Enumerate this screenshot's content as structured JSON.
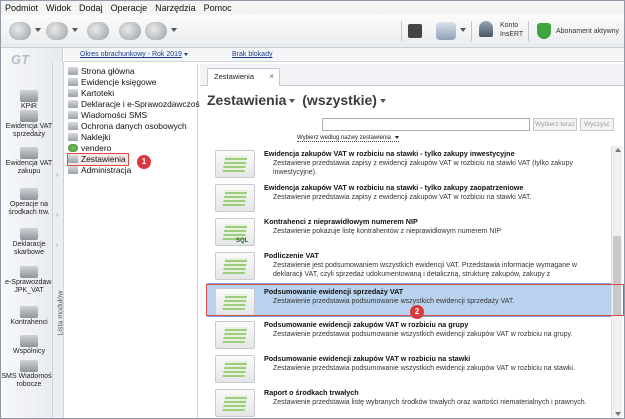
{
  "menu": [
    "Podmiot",
    "Widok",
    "Dodaj",
    "Operacje",
    "Narzędzia",
    "Pomoc"
  ],
  "toolbar": {
    "konto_line1": "Konto",
    "konto_line2": "InsERT",
    "abonament": "Abonament aktywny"
  },
  "period": {
    "label": "Okres obrachunkowy - Rok 2019",
    "blokady": "Brak blokady"
  },
  "leftbar": {
    "logo": "GT",
    "items": [
      "KPiR",
      "Ewidencja VAT sprzedaży",
      "Ewidencja VAT zakupu",
      "Operacje na środkach trw.",
      "Deklaracje skarbowe",
      "e-Sprawozdaw. JPK_VAT",
      "Kontrahenci",
      "Wspólnicy",
      "SMS Wiadomości robocze"
    ],
    "vertical_label": "Lista modułów"
  },
  "nav": {
    "items": [
      "Strona główna",
      "Ewidencje księgowe",
      "Kartoteki",
      "Deklaracje i e-Sprawozdawczość",
      "Wiadomości SMS",
      "Ochrona danych osobowych",
      "Naklejki",
      "vendero",
      "Zestawienia",
      "Administracja"
    ],
    "selected_index": 8,
    "badge": "1"
  },
  "main": {
    "tab_label": "Zestawienia",
    "heading_main": "Zestawienia",
    "heading_filter": "(wszystkie)",
    "search_placeholder": "",
    "search_button": "Wybierz teraz",
    "clear_button": "Wyczyść",
    "sort_label": "Wybierz według nazwy zestawienia",
    "badge": "2",
    "rows": [
      {
        "title": "Ewidencja zakupów VAT w rozbiciu na stawki - tylko zakupy inwestycyjne",
        "desc": "Zestawienie przedstawia zapisy z ewidencji zakupów VAT w rozbiciu na stawki VAT (tylko zakupy inwestycyjne)."
      },
      {
        "title": "Ewidencja zakupów VAT w rozbiciu na stawki - tylko zakupy zaopatrzeniowe",
        "desc": "Zestawienie przedstawia zapisy z ewidencji zakupów VAT w rozbiciu na stawki VAT."
      },
      {
        "title": "Kontrahenci z nieprawidłowym numerem NIP",
        "desc": "Zestawienie pokazuje listę kontrahentów z nieprawidłowym numerem NIP"
      },
      {
        "title": "Podliczenie VAT",
        "desc": "Zestawienie jest podsumowaniem wszystkich ewidencji VAT. Przedstawia informacje wymagane w deklaracji VAT, czyli sprzedaż udokumentowaną i detaliczną, strukturę zakupów, zakupy z"
      },
      {
        "title": "Podsumowanie ewidencji sprzedaży VAT",
        "desc": "Zestawienie przedstawia podsumowanie wszystkich ewidencji sprzedaży VAT."
      },
      {
        "title": "Podsumowanie ewidencji zakupów VAT w rozbiciu na grupy",
        "desc": "Zestawienie przedstawia podsumowanie wszystkich ewidencji zakupów VAT w rozbiciu na grupy."
      },
      {
        "title": "Podsumowanie ewidencji zakupów VAT w rozbiciu na stawki",
        "desc": "Zestawienie przedstawia podsumowanie wszystkich ewidencji zakupów VAT w rozbiciu na stawki."
      },
      {
        "title": "Raport o środkach trwałych",
        "desc": "Zestawienie przedstawia listę wybranych środków trwałych oraz wartości niematerialnych i prawnych."
      }
    ],
    "sql_label": "SQL"
  }
}
